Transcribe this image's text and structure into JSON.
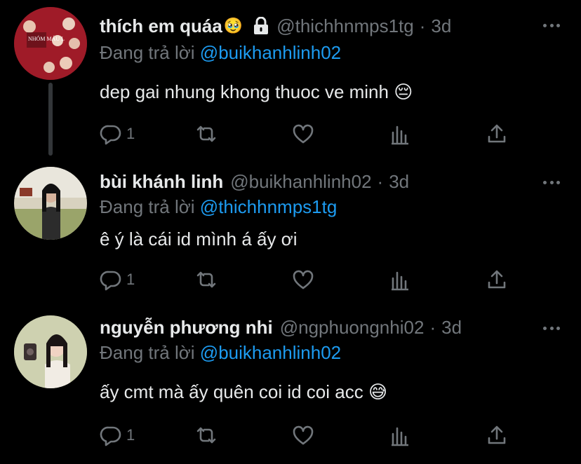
{
  "tweets": [
    {
      "display_name": "thích em quáa",
      "name_emoji": "🥹",
      "handle": "@thichhnmps1tg",
      "separator": "·",
      "time": "3d",
      "replying_prefix": "Đang trả lời",
      "replying_to": "@buikhanhlinh02",
      "text": "dep gai nhung khong thuoc ve minh 😔",
      "reply_count": "1",
      "avatar_text": "NHÓM MÁU L"
    },
    {
      "display_name": "bùi khánh linh",
      "handle": "@buikhanhlinh02",
      "separator": "·",
      "time": "3d",
      "replying_prefix": "Đang trả lời",
      "replying_to": "@thichhnmps1tg",
      "text": "ê ý là cái id mình á ấy ơi",
      "reply_count": "1"
    },
    {
      "display_name": "nguyễn phương nhi",
      "handle": "@ngphuongnhi02",
      "separator": "·",
      "time": "3d",
      "replying_prefix": "Đang trả lời",
      "replying_to": "@buikhanhlinh02",
      "text": "ấy cmt mà ấy quên coi id coi acc 😅",
      "reply_count": "1"
    }
  ],
  "colors": {
    "background": "#000000",
    "text": "#e7e9ea",
    "muted": "#71767b",
    "link": "#1d9bf0",
    "thread_line": "#333639"
  },
  "icons": [
    "lock-icon",
    "more-icon",
    "reply-icon",
    "retweet-icon",
    "like-icon",
    "analytics-icon",
    "share-icon"
  ]
}
